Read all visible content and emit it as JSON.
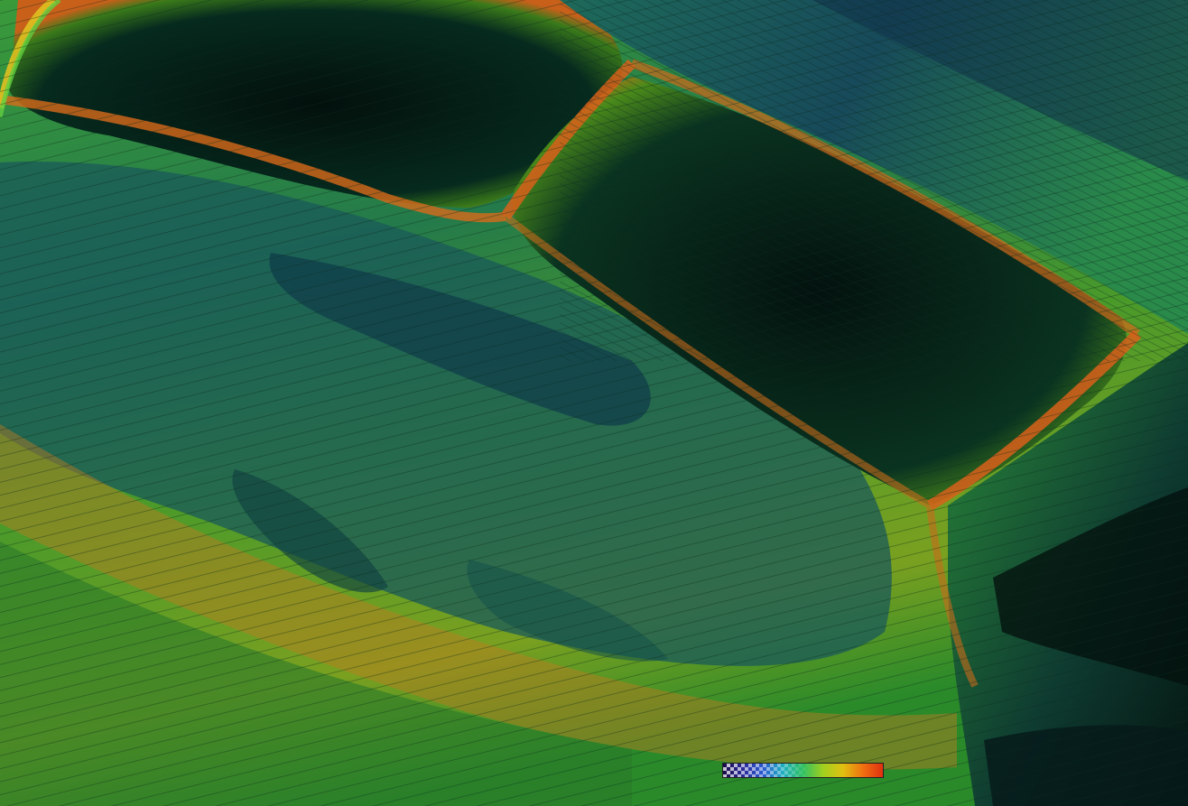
{
  "scene": {
    "description_name": "terrain-visualization",
    "palette": {
      "deep": "#041410",
      "dark_teal": "#0d3b3a",
      "blue_teal": "#1a5a6a",
      "green": "#2f8f3a",
      "yellow_green": "#8fb82a",
      "orange": "#d8701a",
      "red_orange": "#c84a14"
    }
  },
  "colorbar": {
    "gradient_stops": [
      "#1a0a4a",
      "#2a2a9a",
      "#2a5ad0",
      "#20b0c0",
      "#30c060",
      "#a0d020",
      "#e0c010",
      "#f07010",
      "#e03010"
    ],
    "pattern": "checkerboard-left"
  }
}
